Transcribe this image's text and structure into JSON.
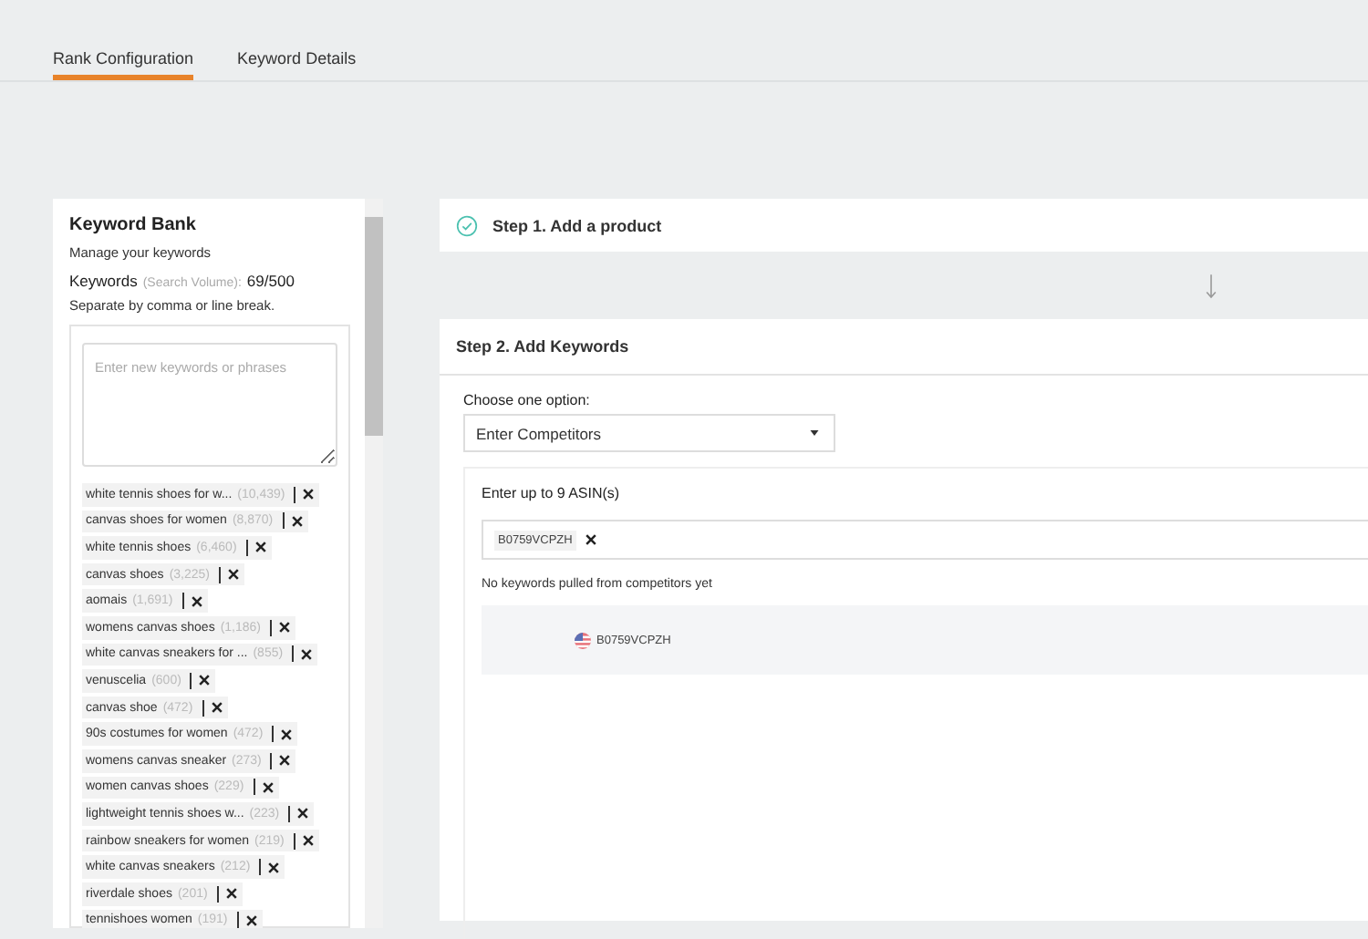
{
  "tabs": [
    {
      "label": "Rank Configuration",
      "selected": true
    },
    {
      "label": "Keyword Details",
      "selected": false
    }
  ],
  "keyword_bank": {
    "title": "Keyword Bank",
    "subtitle": "Manage your keywords",
    "keywords_label": "Keywords",
    "volume_label": "(Search Volume):",
    "count": "69/500",
    "hint": "Separate by comma or line break.",
    "input": {
      "placeholder": "Enter new keywords or phrases"
    },
    "keywords": [
      {
        "text": "white tennis shoes for w...",
        "volume": "(10,439)"
      },
      {
        "text": "canvas shoes for women",
        "volume": "(8,870)"
      },
      {
        "text": "white tennis shoes",
        "volume": "(6,460)"
      },
      {
        "text": "canvas shoes",
        "volume": "(3,225)"
      },
      {
        "text": "aomais",
        "volume": "(1,691)"
      },
      {
        "text": "womens canvas shoes",
        "volume": "(1,186)"
      },
      {
        "text": "white canvas sneakers for ...",
        "volume": "(855)"
      },
      {
        "text": "venuscelia",
        "volume": "(600)"
      },
      {
        "text": "canvas shoe",
        "volume": "(472)"
      },
      {
        "text": "90s costumes for women",
        "volume": "(472)"
      },
      {
        "text": "womens canvas sneaker",
        "volume": "(273)"
      },
      {
        "text": "women canvas shoes",
        "volume": "(229)"
      },
      {
        "text": "lightweight tennis shoes w...",
        "volume": "(223)"
      },
      {
        "text": "rainbow sneakers for women",
        "volume": "(219)"
      },
      {
        "text": "white canvas sneakers",
        "volume": "(212)"
      },
      {
        "text": "riverdale shoes",
        "volume": "(201)"
      },
      {
        "text": "tennishoes women",
        "volume": "(191)"
      }
    ]
  },
  "step1": {
    "title": "Step 1. Add a product",
    "done": true
  },
  "step2": {
    "title": "Step 2. Add Keywords",
    "option_label": "Choose one option:",
    "option_value": "Enter Competitors",
    "asin_label": "Enter up to 9 ASIN(s)",
    "asin_tags": [
      "B0759VCPZH"
    ],
    "empty_message": "No keywords pulled from competitors yet",
    "competitors": [
      {
        "asin": "B0759VCPZH"
      }
    ]
  }
}
